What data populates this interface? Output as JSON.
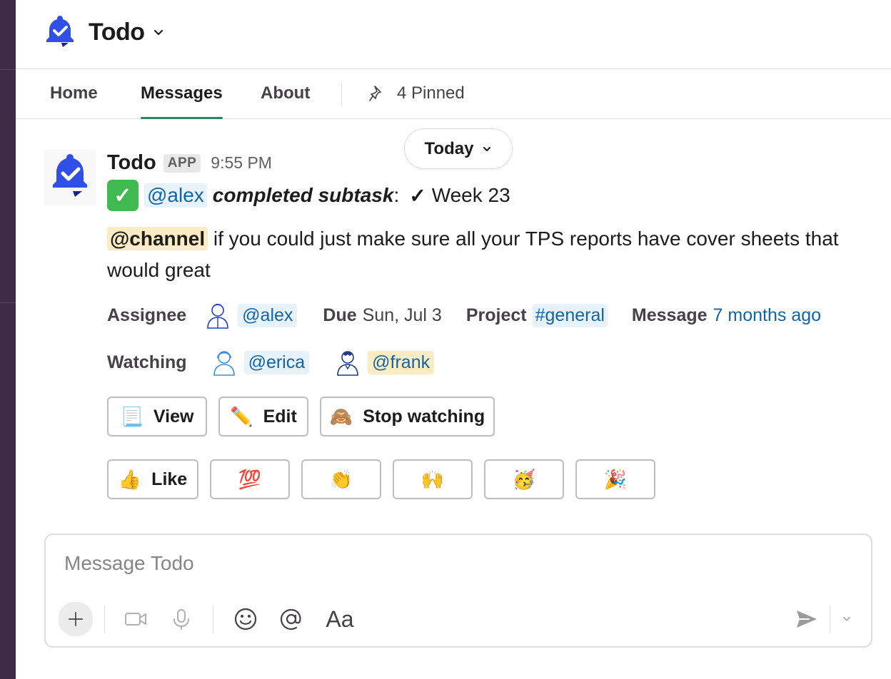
{
  "header": {
    "title": "Todo"
  },
  "tabs": [
    {
      "label": "Home"
    },
    {
      "label": "Messages"
    },
    {
      "label": "About"
    }
  ],
  "pinned_label": "4 Pinned",
  "date_pill": "Today",
  "message": {
    "sender": "Todo",
    "badge": "APP",
    "time": "9:55 PM",
    "check_icon": "✓",
    "actor": "@alex",
    "action": "completed subtask",
    "colon": ":",
    "subtask_check": "✓",
    "subtask": "Week 23",
    "channel_mention": "@channel",
    "body": " if you could just make sure all your TPS reports have cover sheets that would great"
  },
  "fields": {
    "assignee_label": "Assignee",
    "assignee": "@alex",
    "due_label": "Due",
    "due_value": "Sun, Jul 3",
    "project_label": "Project",
    "project": "#general",
    "message_label": "Message",
    "message_link": "7 months ago",
    "watching_label": "Watching",
    "watchers": [
      "@erica",
      "@frank"
    ]
  },
  "actions": [
    {
      "icon": "page-icon",
      "emoji": "📃",
      "label": "View"
    },
    {
      "icon": "pencil-icon",
      "emoji": "✏️",
      "label": "Edit"
    },
    {
      "icon": "see-no-evil-monkey-icon",
      "emoji": "🙈",
      "label": "Stop watching"
    }
  ],
  "reactions": [
    {
      "icon": "thumbs-up-icon",
      "emoji": "👍",
      "label": "Like"
    },
    {
      "icon": "hundred-points-icon",
      "emoji": "💯",
      "label": ""
    },
    {
      "icon": "clapping-hands-icon",
      "emoji": "👏",
      "label": ""
    },
    {
      "icon": "raising-hands-icon",
      "emoji": "🙌",
      "label": ""
    },
    {
      "icon": "partying-face-icon",
      "emoji": "🥳",
      "label": ""
    },
    {
      "icon": "party-popper-icon",
      "emoji": "🎉",
      "label": ""
    }
  ],
  "composer": {
    "placeholder": "Message Todo",
    "format_label": "Aa"
  },
  "colors": {
    "brand_blue": "#2f4fe8",
    "sidebar": "#3f2b45",
    "link": "#1264a3",
    "tab_underline": "#2f8560",
    "highlight": "#fbecc3"
  }
}
